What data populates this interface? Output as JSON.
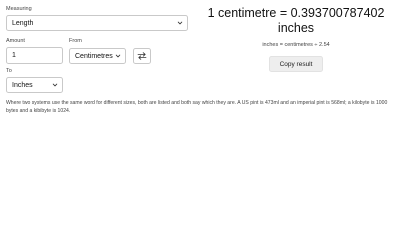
{
  "measuring": {
    "label": "Measuring",
    "selected": "Length"
  },
  "amount": {
    "label": "Amount",
    "value": "1"
  },
  "from": {
    "label": "From",
    "selected": "Centimetres"
  },
  "to": {
    "label": "To",
    "selected": "Inches"
  },
  "swap": {
    "icon": "swap-arrows-icon"
  },
  "result": {
    "text": "1 centimetre = 0.393700787402 inches",
    "formula": "inches = centimetres ÷ 2.54"
  },
  "copy_button": {
    "label": "Copy result"
  },
  "note": "Where two systems use the same word for different sizes, both are listed and both say which they are. A US pint is 473ml and an imperial pint is 568ml; a kilobyte is 1000 bytes and a kibibyte is 1024."
}
